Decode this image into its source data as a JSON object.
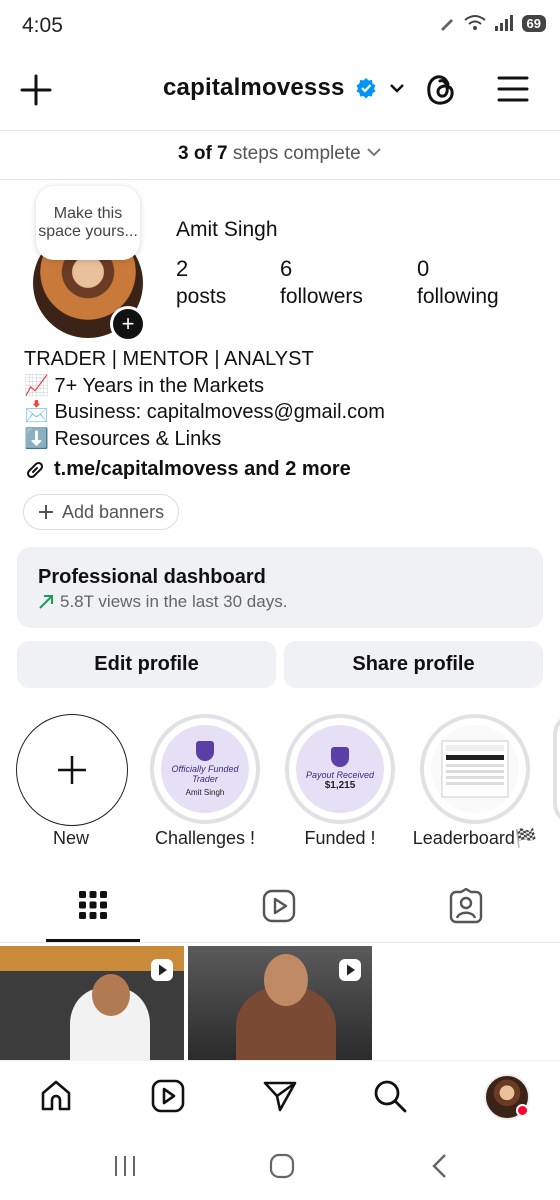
{
  "status_bar": {
    "time": "4:05",
    "battery": "69"
  },
  "header": {
    "username": "capitalmovesss"
  },
  "setup": {
    "done": "3 of 7",
    "rest": "steps complete"
  },
  "profile": {
    "tooltip": "Make this space yours...",
    "name": "Amit Singh",
    "stats": [
      {
        "count": "2",
        "label": "posts"
      },
      {
        "count": "6",
        "label": "followers"
      },
      {
        "count": "0",
        "label": "following"
      }
    ],
    "bio": [
      "TRADER | MENTOR | ANALYST",
      "📈 7+ Years in the Markets",
      "📩 Business: capitalmovess@gmail.com",
      "⬇️ Resources & Links"
    ],
    "link": "t.me/capitalmovess and 2 more",
    "add_banners": "Add banners"
  },
  "dashboard": {
    "title": "Professional dashboard",
    "subtitle": "5.8T views in the last 30 days."
  },
  "buttons": {
    "edit": "Edit profile",
    "share": "Share profile"
  },
  "highlights": [
    {
      "label": "New"
    },
    {
      "label": "Challenges !",
      "card_line1": "Officially Funded Trader",
      "card_line2": "Amit Singh"
    },
    {
      "label": "Funded !",
      "card_line1": "Payout Received",
      "card_line2": "$1,215"
    },
    {
      "label": "Leaderboard🏁"
    }
  ],
  "colors": {
    "verified": "#0095f6",
    "accent_green": "#1a9e56",
    "notification": "#ff0033"
  }
}
